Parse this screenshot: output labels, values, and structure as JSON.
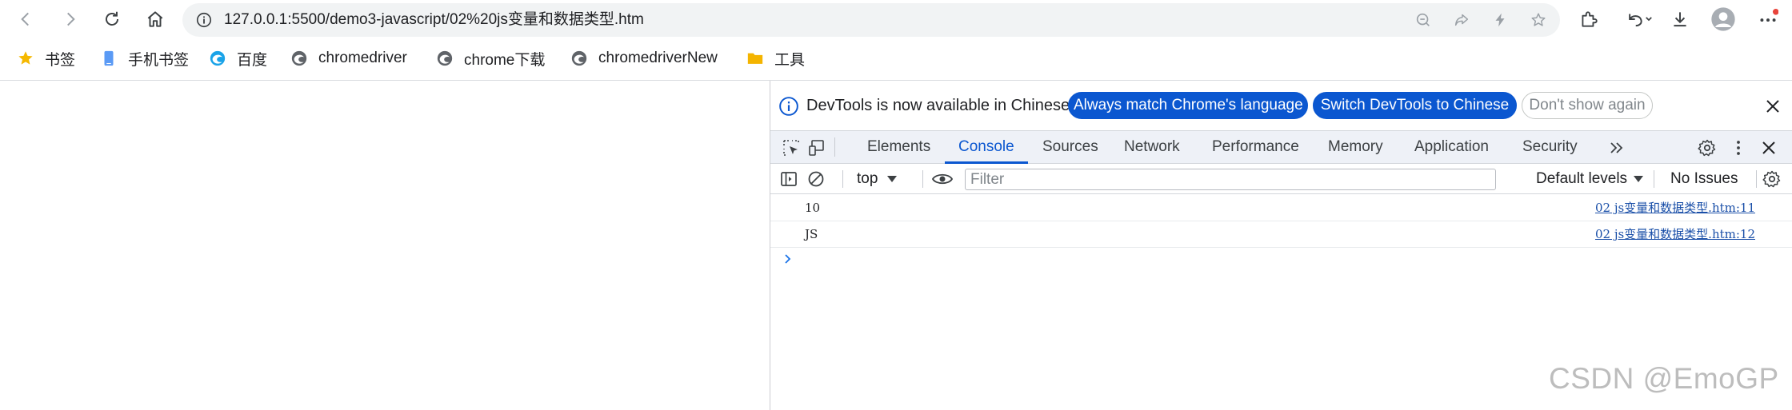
{
  "toolbar": {
    "url": "127.0.0.1:5500/demo3-javascript/02%20js变量和数据类型.htm"
  },
  "bookmarks": [
    {
      "label": "书签",
      "icon": "star-icon"
    },
    {
      "label": "手机书签",
      "icon": "phone-icon"
    },
    {
      "label": "百度",
      "icon": "edge-icon"
    },
    {
      "label": "chromedriver",
      "icon": "site-icon"
    },
    {
      "label": "chrome下载",
      "icon": "site-icon"
    },
    {
      "label": "chromedriverNew",
      "icon": "site-icon"
    },
    {
      "label": "工具",
      "icon": "folder-icon"
    }
  ],
  "devtools": {
    "infobar": {
      "message": "DevTools is now available in Chinese!",
      "always_match": "Always match Chrome's language",
      "switch": "Switch DevTools to Chinese",
      "dont_show": "Don't show again"
    },
    "tabs": [
      "Elements",
      "Console",
      "Sources",
      "Network",
      "Performance",
      "Memory",
      "Application",
      "Security"
    ],
    "active_tab": "Console",
    "console_bar": {
      "context": "top",
      "filter_placeholder": "Filter",
      "levels": "Default levels",
      "issues": "No Issues"
    },
    "logs": [
      {
        "message": "10",
        "source": "02 js变量和数据类型.htm:11"
      },
      {
        "message": "JS",
        "source": "02 js变量和数据类型.htm:12"
      }
    ]
  },
  "watermark": "CSDN @EmoGP",
  "colors": {
    "accent": "#0b57d0",
    "tab_bar_bg": "#eef1f7",
    "link": "#1a4fa8",
    "notification_dot": "#e8453c"
  }
}
